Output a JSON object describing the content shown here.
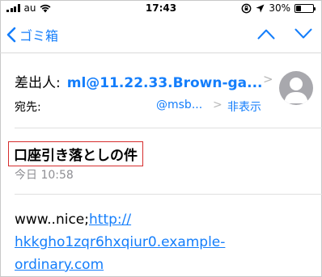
{
  "status_bar": {
    "carrier": "au",
    "time": "17:43",
    "battery_percent": "30%",
    "battery_level": 0.3,
    "icons": [
      "signal-bars-icon",
      "wifi-icon",
      "orientation-lock-icon",
      "location-arrow-icon",
      "battery-icon"
    ]
  },
  "nav": {
    "back_label": "ゴミ箱",
    "icons": [
      "back-chevron-icon",
      "previous-message-icon",
      "next-message-icon"
    ]
  },
  "header": {
    "from_label": "差出人:",
    "from_value": "ml@11.22.33.Brown-ga...",
    "to_label": "宛先:",
    "to_value": "@msb...",
    "hide_label": "非表示",
    "avatar_icon": "person-silhouette-icon"
  },
  "message": {
    "subject": "口座引き落としの件",
    "date": "今日 10:58",
    "body_prefix": "www..nice;",
    "link_line1": "http://",
    "link_line2": "hkkgho1zqr6hxqiur0.example-",
    "link_line3": "ordinary.com"
  },
  "colors": {
    "accent": "#147efb",
    "subject_highlight_border": "#d62d2d",
    "secondary_text": "#8e8e93",
    "avatar": "#a8a8ad"
  }
}
